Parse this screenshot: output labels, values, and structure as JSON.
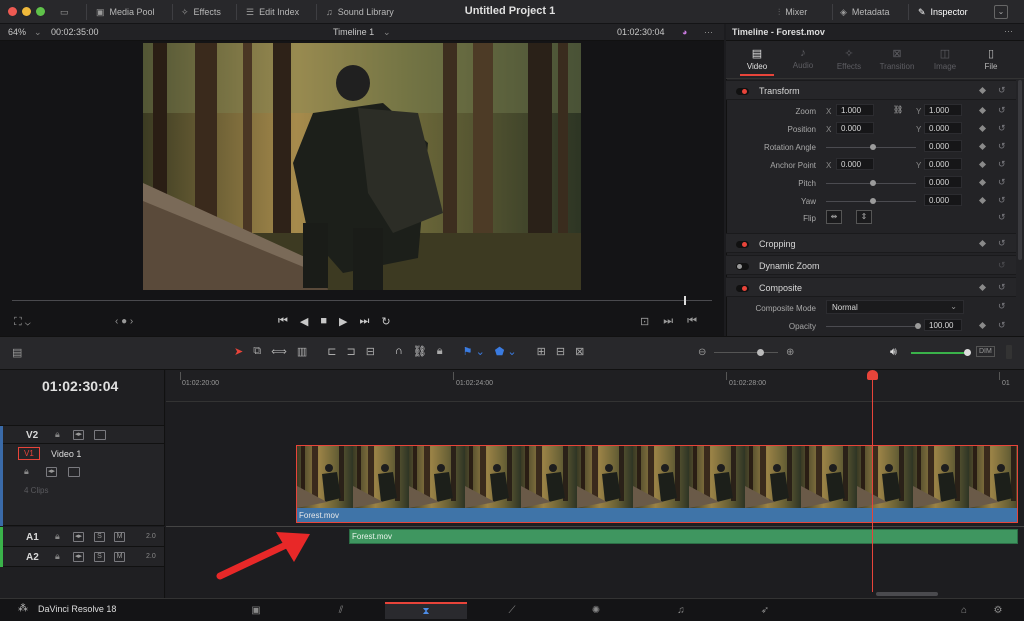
{
  "window": {
    "title": "Untitled Project 1"
  },
  "toolbar": {
    "media_pool": "Media Pool",
    "effects": "Effects",
    "edit_index": "Edit Index",
    "sound_library": "Sound Library",
    "mixer": "Mixer",
    "metadata": "Metadata",
    "inspector": "Inspector"
  },
  "viewer": {
    "zoom": "64%",
    "duration": "00:02:35:00",
    "timeline_name": "Timeline 1",
    "timecode": "01:02:30:04",
    "playhead_position": 0.96
  },
  "inspector": {
    "title": "Timeline - Forest.mov",
    "tabs": [
      {
        "label": "Video",
        "icon": "video-icon",
        "active": true
      },
      {
        "label": "Audio",
        "icon": "music-note-icon",
        "active": false
      },
      {
        "label": "Effects",
        "icon": "effects-icon",
        "active": false
      },
      {
        "label": "Transition",
        "icon": "transition-icon",
        "active": false
      },
      {
        "label": "Image",
        "icon": "image-icon",
        "active": false
      },
      {
        "label": "File",
        "icon": "file-icon",
        "active": false
      }
    ],
    "sections": {
      "transform": "Transform",
      "cropping": "Cropping",
      "dynamic_zoom": "Dynamic Zoom",
      "composite": "Composite"
    },
    "params": {
      "zoom_label": "Zoom",
      "zoom_x": "1.000",
      "zoom_y": "1.000",
      "position_label": "Position",
      "position_x": "0.000",
      "position_y": "0.000",
      "rotation_label": "Rotation Angle",
      "rotation": "0.000",
      "anchor_label": "Anchor Point",
      "anchor_x": "0.000",
      "anchor_y": "0.000",
      "pitch_label": "Pitch",
      "pitch": "0.000",
      "yaw_label": "Yaw",
      "yaw": "0.000",
      "flip_label": "Flip",
      "composite_mode_label": "Composite Mode",
      "composite_mode": "Normal",
      "opacity_label": "Opacity",
      "opacity": "100.00",
      "x": "X",
      "y": "Y"
    }
  },
  "timeline": {
    "timecode": "01:02:30:04",
    "ruler": [
      "01:02:20:00",
      "01:02:24:00",
      "01:02:28:00"
    ],
    "tracks": {
      "v2": "V2",
      "v1_tag": "V1",
      "v1_name": "Video 1",
      "v1_clips": "4 Clips",
      "a1": "A1",
      "a2": "A2",
      "a1_level": "2.0",
      "a2_level": "2.0",
      "solo": "S",
      "mute": "M"
    },
    "video_clip": "Forest.mov",
    "audio_clip": "Forest.mov"
  },
  "footer": {
    "app": "DaVinci Resolve 18"
  },
  "colors": {
    "accent_red": "#e8443a",
    "clip_blue": "#3f74a8",
    "audio_green": "#3f9660",
    "playhead": "#e8443a"
  }
}
